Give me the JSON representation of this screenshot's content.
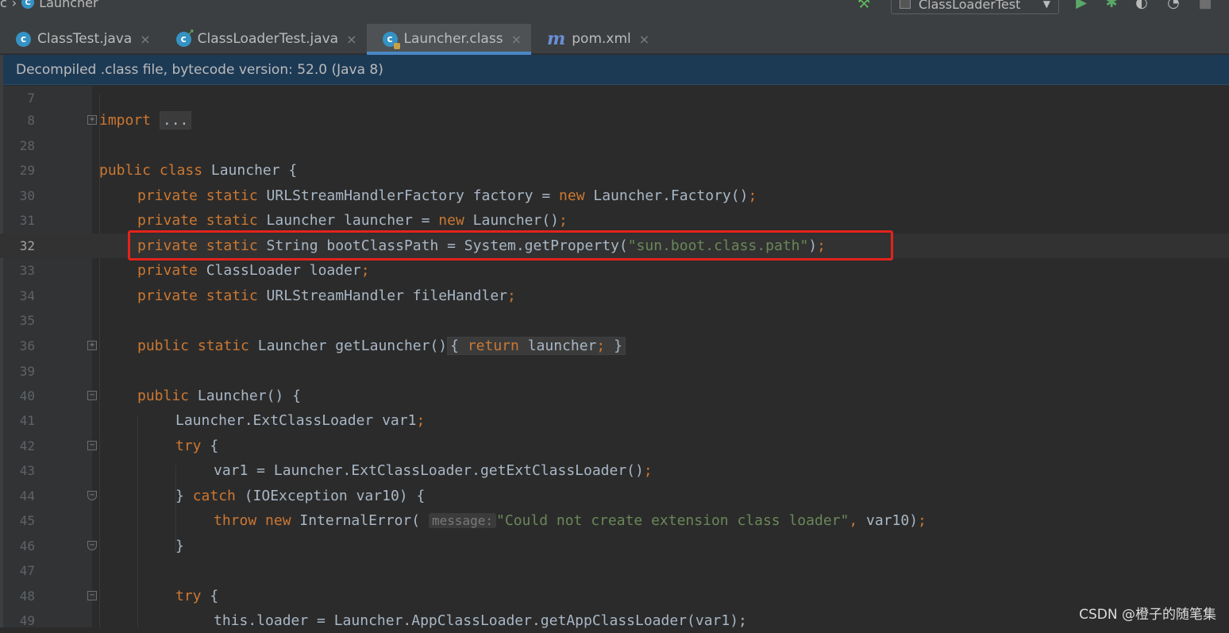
{
  "breadcrumb": {
    "icon": "C",
    "label": "Launcher",
    "prefix": "c"
  },
  "toolbar": {
    "run_config": "ClassLoaderTest"
  },
  "tabs": [
    {
      "label": "ClassTest.java",
      "icon": "class-icon"
    },
    {
      "label": "ClassLoaderTest.java",
      "icon": "class-icon"
    },
    {
      "label": "Launcher.class",
      "icon": "class-file-icon",
      "active": true
    },
    {
      "label": "pom.xml",
      "icon": "maven-icon"
    }
  ],
  "tab_close": "×",
  "banner": {
    "text": "Decompiled .class file, bytecode version: 52.0 (Java 8)"
  },
  "editor": {
    "current_line": "32",
    "line_numbers": [
      "7",
      "8",
      "28",
      "29",
      "30",
      "31",
      "32",
      "33",
      "34",
      "35",
      "36",
      "39",
      "40",
      "41",
      "42",
      "43",
      "44",
      "45",
      "46",
      "47",
      "48",
      "49"
    ],
    "code": {
      "l8_import": "import",
      "l8_fold": "...",
      "l29_kw": "public class",
      "l29_rest": " Launcher {",
      "l30_kw": "private static",
      "l30_a": " URLStreamHandlerFactory factory = ",
      "l30_new": "new",
      "l30_b": " Launcher.Factory()",
      "l30_semi": ";",
      "l31_kw": "private static",
      "l31_a": " Launcher launcher = ",
      "l31_new": "new",
      "l31_b": " Launcher()",
      "l31_semi": ";",
      "l32_kw": "private static",
      "l32_a": " String bootClassPath = System.getProperty(",
      "l32_str": "\"sun.boot.class.path\"",
      "l32_b": ")",
      "l32_semi": ";",
      "l33_kw": "private",
      "l33_a": " ClassLoader loader",
      "l33_semi": ";",
      "l34_kw": "private static",
      "l34_a": " URLStreamHandler fileHandler",
      "l34_semi": ";",
      "l36_kw": "public static",
      "l36_a": " Launcher getLauncher()",
      "l36_open": "{ ",
      "l36_return": "return",
      "l36_b": " launcher",
      "l36_semi": ";",
      "l36_close": " }",
      "l40_kw": "public",
      "l40_a": " Launcher() {",
      "l41_a": "Launcher.ExtClassLoader var1",
      "l41_semi": ";",
      "l42_try": "try",
      "l42_a": " {",
      "l43_a": "var1 = Launcher.ExtClassLoader.getExtClassLoader()",
      "l43_semi": ";",
      "l44_a": "} ",
      "l44_catch": "catch",
      "l44_b": " (IOException var10) {",
      "l45_throw": "throw new",
      "l45_a": " InternalError(",
      "l45_hint": "message:",
      "l45_str": "\"Could not create extension class loader\"",
      "l45_comma": ",",
      "l45_b": " var10)",
      "l45_semi": ";",
      "l46_a": "}",
      "l48_try": "try",
      "l48_a": " {",
      "l49_a": "this.loader = Launcher.AppClassLoader.getAppClassLoader(var1);"
    }
  },
  "watermark": "CSDN @橙子的随笔集",
  "colors": {
    "keyword": "#cc7832",
    "string": "#6a8759",
    "text": "#a9b7c6",
    "highlight_box": "#e4231c",
    "banner_bg": "#1d3a55"
  }
}
